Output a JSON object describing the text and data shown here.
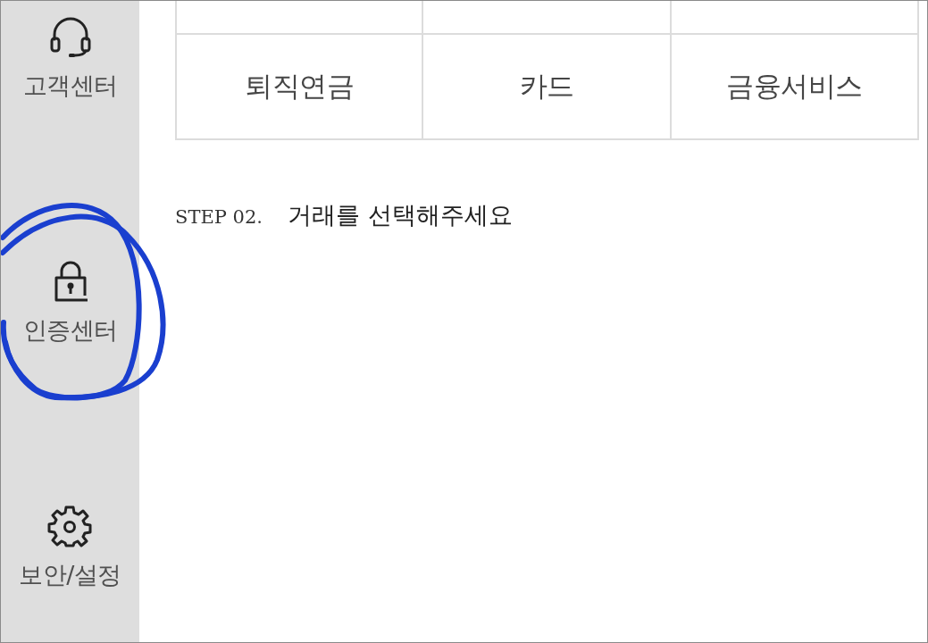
{
  "sidebar": {
    "items": [
      {
        "kind": "support",
        "label": "고객센터",
        "circled": false
      },
      {
        "kind": "certification",
        "label": "인증센터",
        "circled": true
      },
      {
        "kind": "settings",
        "label": "보안/설정",
        "circled": false
      }
    ]
  },
  "menu_grid": {
    "items": [
      "퇴직연금",
      "카드",
      "금융서비스"
    ]
  },
  "step": {
    "number": "STEP 02.",
    "title": "거래를 선택해주세요"
  }
}
